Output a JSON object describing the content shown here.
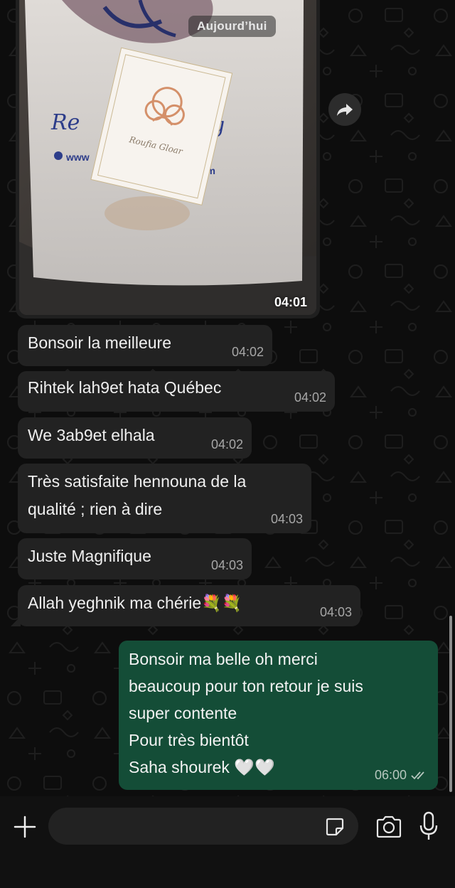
{
  "date_chip": "Aujourd’hui",
  "image_message": {
    "time": "04:01",
    "card_text": "Roufia Gloar",
    "bag_text_1": "www",
    "bag_text_2": "om"
  },
  "incoming_messages": [
    {
      "text": "Bonsoir la meilleure",
      "time": "04:02"
    },
    {
      "text": "Rihtek lah9et hata Québec",
      "time": "04:02"
    },
    {
      "text": "We 3ab9et elhala",
      "time": "04:02"
    },
    {
      "text": "Très satisfaite hennouna de la\nqualité ; rien à dire",
      "time": "04:03"
    },
    {
      "text": "Juste Magnifique",
      "time": "04:03"
    },
    {
      "text": "Allah yeghnik ma chérie💐💐",
      "time": "04:03"
    }
  ],
  "outgoing_message": {
    "text": "Bonsoir ma belle oh merci\nbeaucoup pour ton retour je suis\nsuper contente\nPour très bientôt\nSaha shourek 🤍🤍",
    "time": "06:00",
    "status": "read"
  },
  "input_bar": {
    "placeholder": "",
    "icons": [
      "plus-icon",
      "sticker-icon",
      "camera-icon",
      "microphone-icon"
    ]
  },
  "colors": {
    "incoming_bubble": "#222222",
    "outgoing_bubble": "#144d37",
    "background": "#0b0b0b"
  }
}
